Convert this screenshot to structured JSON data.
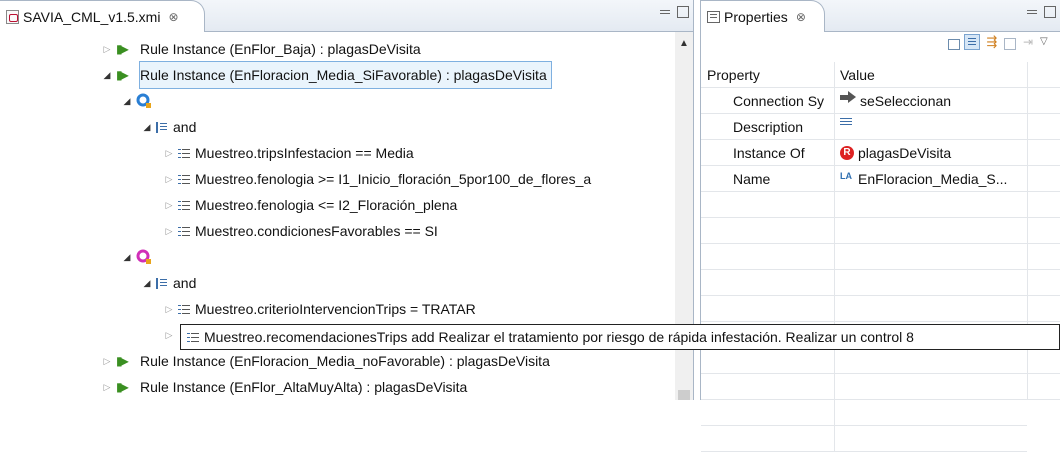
{
  "editor": {
    "tab_title": "SAVIA_CML_v1.5.xmi",
    "tab_close": "⊗",
    "tree": [
      {
        "label": "Rule Instance (EnFlor_Baja) : plagasDeVisita",
        "expanded": false
      },
      {
        "label": "Rule Instance (EnFloracion_Media_SiFavorable) : plagasDeVisita",
        "expanded": true,
        "selected": true
      },
      {
        "label": "",
        "icon": "condition-query-icon",
        "expanded": true
      },
      {
        "label": "and",
        "expanded": true
      },
      {
        "label": "Muestreo.tripsInfestacion == Media",
        "expanded": false
      },
      {
        "label": "Muestreo.fenologia >= I1_Inicio_floración_5por100_de_flores_a",
        "expanded": false
      },
      {
        "label": "Muestreo.fenologia <= I2_Floración_plena",
        "expanded": false
      },
      {
        "label": "Muestreo.condicionesFavorables == SI",
        "expanded": false
      },
      {
        "label": "",
        "icon": "action-query-icon",
        "expanded": true
      },
      {
        "label": "and",
        "expanded": true
      },
      {
        "label": "Muestreo.criterioIntervencionTrips = TRATAR",
        "expanded": false
      },
      {
        "label": "Muestreo.recomendacionesTrips add Realizar el tratamiento por riesgo de rápida infestación. Realizar un control 8",
        "expanded": false
      },
      {
        "label": "Rule Instance (EnFloracion_Media_noFavorable) : plagasDeVisita",
        "expanded": false
      },
      {
        "label": "Rule Instance (EnFlor_AltaMuyAlta) : plagasDeVisita",
        "expanded": false
      }
    ]
  },
  "properties": {
    "tab_title": "Properties",
    "tab_close": "⊗",
    "columns": [
      "Property",
      "Value"
    ],
    "rows": [
      {
        "property": "Connection Sy",
        "value": "seSeleccionan",
        "icon": "arrow-icon"
      },
      {
        "property": "Description",
        "value": "",
        "icon": "description-icon"
      },
      {
        "property": "Instance Of",
        "value": "plagasDeVisita",
        "icon": "rule-icon"
      },
      {
        "property": "Name",
        "value": "EnFloracion_Media_S...",
        "icon": "text-attribute-icon"
      }
    ]
  },
  "colors": {
    "rule_icon": "#3a8f21",
    "selection": "#eaf4fc",
    "accent": "#3c6ea8"
  }
}
